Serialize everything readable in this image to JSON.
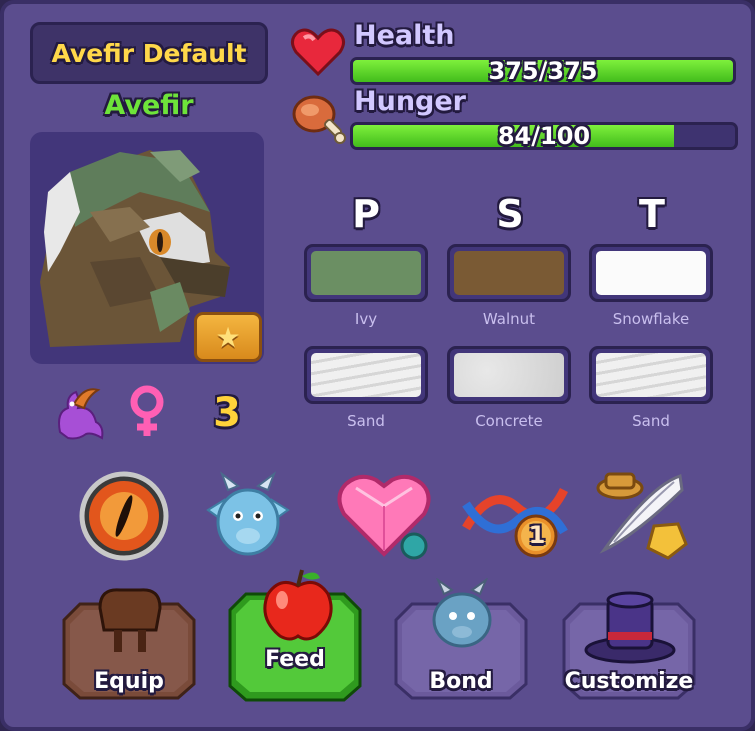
{
  "pet": {
    "display_name": "Avefir Default",
    "species": "Avefir",
    "level": "3"
  },
  "stats": {
    "health": {
      "label": "Health",
      "text": "375/375",
      "fill": 1.0
    },
    "hunger": {
      "label": "Hunger",
      "text": "84/100",
      "fill": 0.84
    }
  },
  "traits": {
    "headers": [
      "P",
      "S",
      "T"
    ],
    "colors": [
      {
        "label": "Ivy",
        "color": "#6b8f63"
      },
      {
        "label": "Walnut",
        "color": "#7a5a34"
      },
      {
        "label": "Snowflake",
        "color": "#fbfbfb"
      }
    ],
    "textures": [
      {
        "label": "Sand",
        "color": "#e6e6e6"
      },
      {
        "label": "Concrete",
        "color": "#dadada"
      },
      {
        "label": "Sand",
        "color": "#e6e6e6"
      }
    ]
  },
  "icons": {
    "info_row": [
      "dragon-icon",
      "female-icon"
    ],
    "actions": [
      "eye-icon",
      "baby-dragon-icon",
      "heart-gem-icon",
      "dna-icon",
      "quill-hat-icon"
    ],
    "dna_badge": "1"
  },
  "buttons": {
    "equip": "Equip",
    "feed": "Feed",
    "bond": "Bond",
    "customize": "Customize"
  },
  "colors": {
    "panel": "#5b4d8e",
    "accent_green": "#6ee33a",
    "name_yellow": "#ffd84a"
  }
}
